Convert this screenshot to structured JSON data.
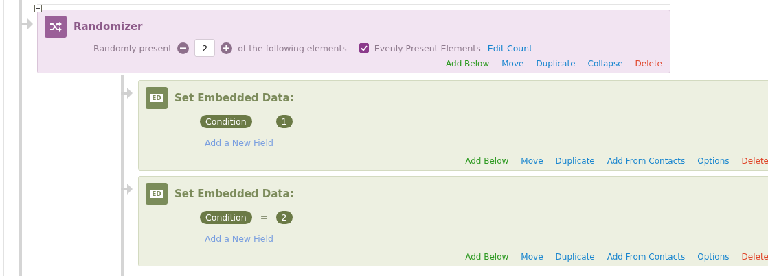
{
  "randomizer": {
    "title": "Randomizer",
    "present_label": "Randomly present",
    "count": "2",
    "suffix": "of the following elements",
    "evenly": {
      "label": "Evenly Present Elements",
      "checked": true
    },
    "edit_count": "Edit Count",
    "actions": [
      {
        "label": "Add Below",
        "kind": "add"
      },
      {
        "label": "Move",
        "kind": "link"
      },
      {
        "label": "Duplicate",
        "kind": "link"
      },
      {
        "label": "Collapse",
        "kind": "link"
      },
      {
        "label": "Delete",
        "kind": "delete"
      }
    ]
  },
  "elements": [
    {
      "title": "Set Embedded Data:",
      "icon_label": "ED",
      "fields": [
        {
          "name": "Condition",
          "operator": "=",
          "value": "1"
        }
      ],
      "add_field": "Add a New Field",
      "actions": [
        {
          "label": "Add Below",
          "kind": "add"
        },
        {
          "label": "Move",
          "kind": "link"
        },
        {
          "label": "Duplicate",
          "kind": "link"
        },
        {
          "label": "Add From Contacts",
          "kind": "link"
        },
        {
          "label": "Options",
          "kind": "link"
        },
        {
          "label": "Delete",
          "kind": "delete"
        }
      ]
    },
    {
      "title": "Set Embedded Data:",
      "icon_label": "ED",
      "fields": [
        {
          "name": "Condition",
          "operator": "=",
          "value": "2"
        }
      ],
      "add_field": "Add a New Field",
      "actions": [
        {
          "label": "Add Below",
          "kind": "add"
        },
        {
          "label": "Move",
          "kind": "link"
        },
        {
          "label": "Duplicate",
          "kind": "link"
        },
        {
          "label": "Add From Contacts",
          "kind": "link"
        },
        {
          "label": "Options",
          "kind": "link"
        },
        {
          "label": "Delete",
          "kind": "delete"
        }
      ]
    }
  ]
}
